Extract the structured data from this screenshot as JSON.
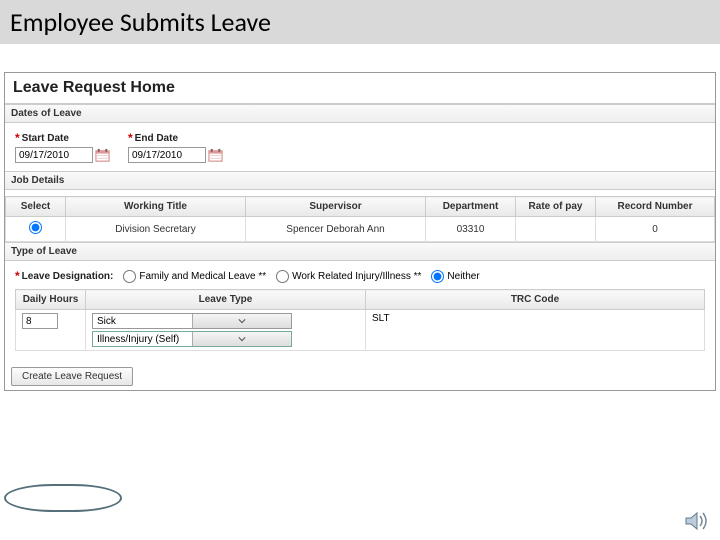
{
  "slide_title": "Employee Submits Leave",
  "page_title": "Leave Request Home",
  "dates": {
    "section_label": "Dates of Leave",
    "start_label": "Start Date",
    "end_label": "End Date",
    "start_value": "09/17/2010",
    "end_value": "09/17/2010"
  },
  "job_details": {
    "section_label": "Job Details",
    "columns": {
      "select": "Select",
      "working_title": "Working Title",
      "supervisor": "Supervisor",
      "department": "Department",
      "rate_of_pay": "Rate of pay",
      "record_number": "Record Number"
    },
    "row": {
      "working_title": "Division Secretary",
      "supervisor": "Spencer Deborah Ann",
      "department": "03310",
      "rate_of_pay": "",
      "record_number": "0"
    }
  },
  "type_of_leave": {
    "section_label": "Type of Leave",
    "designation_label": "Leave Designation:",
    "options": {
      "family": "Family and Medical Leave **",
      "work": "Work Related Injury/Illness **",
      "neither": "Neither"
    },
    "columns": {
      "daily_hours": "Daily Hours",
      "leave_type": "Leave Type",
      "trc_code": "TRC Code"
    },
    "row": {
      "daily_hours": "8",
      "leave_type_primary": "Sick",
      "leave_type_secondary": "Illness/Injury (Self)",
      "trc_code": "SLT"
    }
  },
  "create_button_label": "Create Leave Request"
}
